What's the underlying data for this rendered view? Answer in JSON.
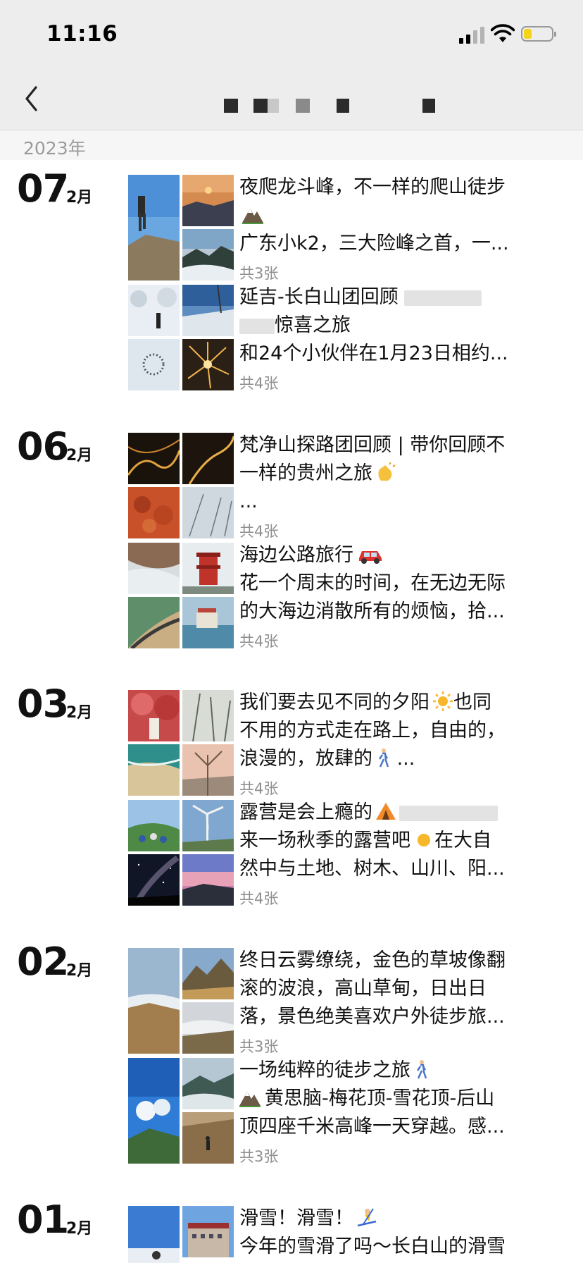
{
  "status_bar": {
    "time": "11:16",
    "battery_level": 0.3
  },
  "nav": {
    "title": ""
  },
  "year_label": "2023年",
  "groups": [
    {
      "day": "07",
      "month": "2月",
      "posts": [
        {
          "lines": [
            "夜爬龙斗峰，不一样的爬山徒步",
            "",
            "广东小k2，三大险峰之首，一..."
          ],
          "count": "共3张"
        },
        {
          "lines": [
            "延吉-长白山团回顾",
            "惊喜之旅",
            "和24个小伙伴在1月23日相约..."
          ],
          "count": "共4张"
        }
      ]
    },
    {
      "day": "06",
      "month": "2月",
      "posts": [
        {
          "lines": [
            "梵净山探路团回顾 | 带你回顾不",
            "一样的贵州之旅",
            "..."
          ],
          "count": "共4张"
        },
        {
          "lines": [
            "海边公路旅行",
            "花一个周末的时间，在无边无际",
            "的大海边消散所有的烦恼，拾..."
          ],
          "count": "共4张"
        }
      ]
    },
    {
      "day": "03",
      "month": "2月",
      "posts": [
        {
          "lines": [
            "我们要去见不同的夕阳",
            "也同",
            "不用的方式走在路上，自由的，",
            "浪漫的，放肆的",
            "..."
          ],
          "count": "共4张"
        },
        {
          "lines": [
            "露营是会上瘾的",
            "来一场秋季的露营吧",
            "在大自",
            "然中与土地、树木、山川、阳..."
          ],
          "count": "共4张"
        }
      ]
    },
    {
      "day": "02",
      "month": "2月",
      "posts": [
        {
          "lines": [
            "终日云雾缭绕，金色的草坡像翻",
            "滚的波浪，高山草甸，日出日",
            "落，景色绝美喜欢户外徒步旅..."
          ],
          "count": "共3张"
        },
        {
          "lines": [
            "一场纯粹的徒步之旅",
            "黄思脑-梅花顶-雪花顶-后山",
            "顶四座千米高峰一天穿越。感..."
          ],
          "count": "共3张"
        }
      ]
    },
    {
      "day": "01",
      "month": "2月",
      "posts": [
        {
          "lines": [
            "滑雪！滑雪！",
            "今年的雪滑了吗～长白山的滑雪"
          ],
          "count": ""
        }
      ]
    }
  ]
}
